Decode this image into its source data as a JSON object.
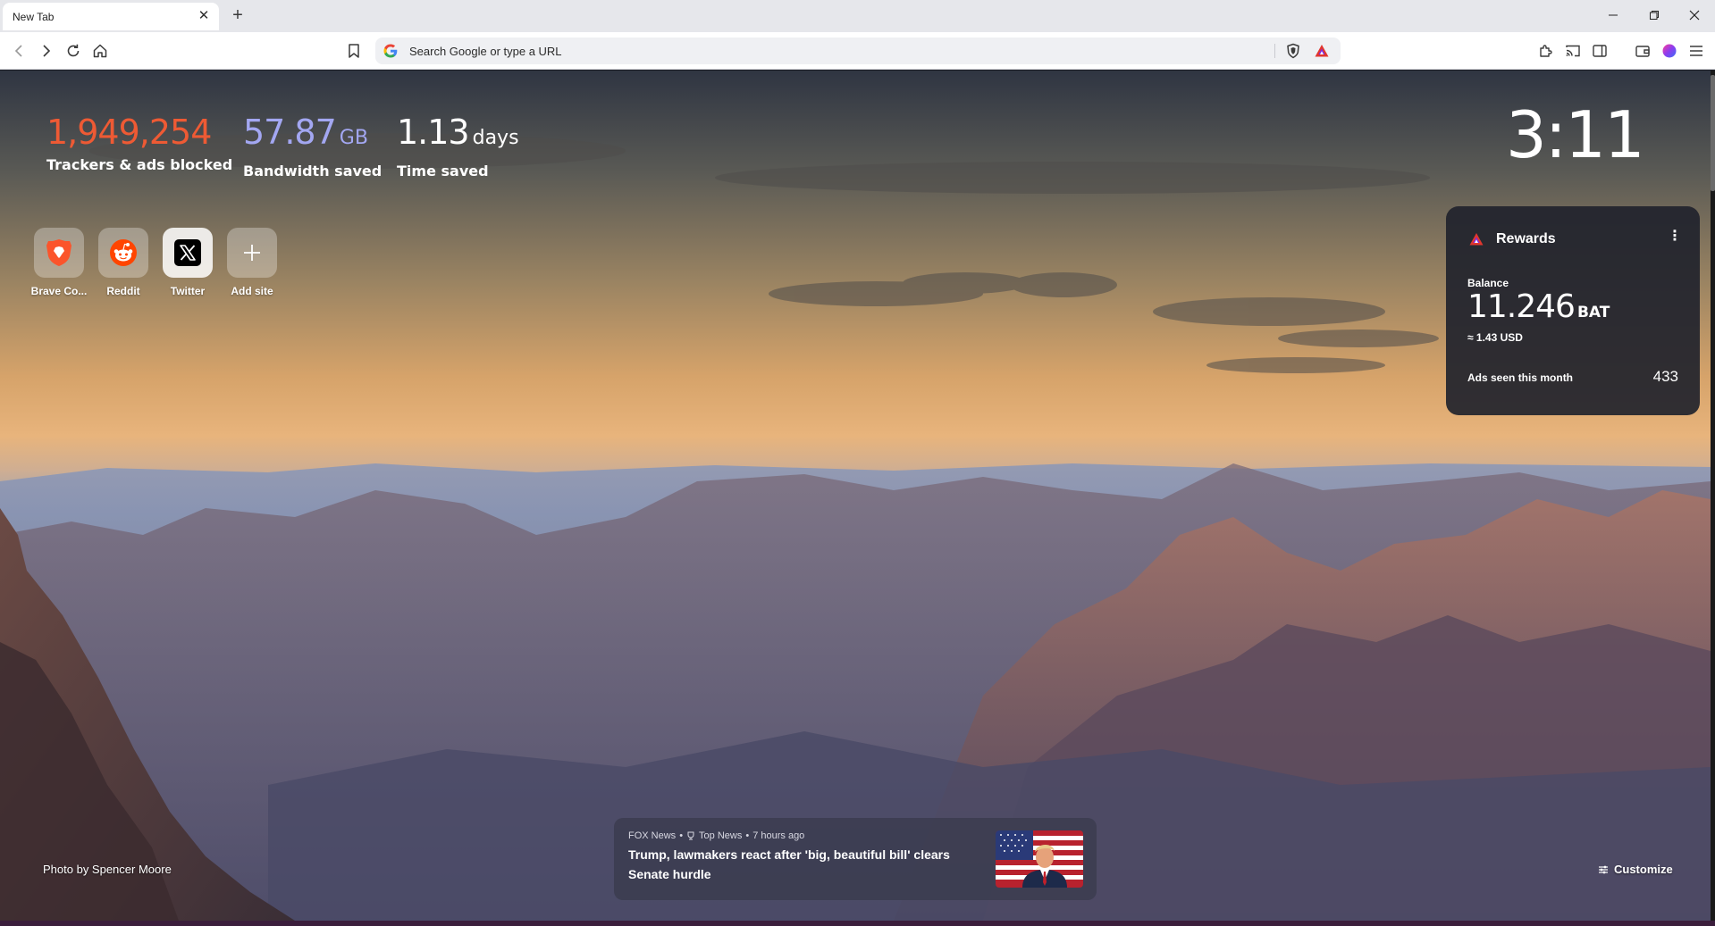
{
  "tab": {
    "title": "New Tab",
    "close_icon": "close-icon",
    "new_tab_icon": "plus-icon"
  },
  "window": {
    "minimize_icon": "minimize-icon",
    "restore_icon": "restore-icon",
    "close_icon": "close-icon"
  },
  "toolbar": {
    "url_placeholder": "Search Google or type a URL",
    "search_engine_icon": "google-icon",
    "icons": [
      "back-icon",
      "forward-icon",
      "reload-icon",
      "home-icon",
      "bookmark-icon",
      "shields-icon",
      "rewards-icon",
      "extensions-icon",
      "cast-icon",
      "sidebar-icon",
      "wallet-icon",
      "profile-icon",
      "menu-icon"
    ]
  },
  "stats": {
    "trackers": {
      "value": "1,949,254",
      "label": "Trackers & ads blocked",
      "color": "#ee5a34"
    },
    "bandwidth": {
      "value": "57.87",
      "unit": "GB",
      "label": "Bandwidth saved",
      "color": "#a3a7f2"
    },
    "time": {
      "value": "1.13",
      "unit": "days",
      "label": "Time saved",
      "color": "#ffffff"
    }
  },
  "clock": "3:11",
  "top_sites": [
    {
      "label": "Brave Co...",
      "icon": "brave-lion-icon"
    },
    {
      "label": "Reddit",
      "icon": "reddit-icon"
    },
    {
      "label": "Twitter",
      "icon": "x-logo-icon"
    },
    {
      "label": "Add site",
      "icon": "plus-icon"
    }
  ],
  "rewards": {
    "title": "Rewards",
    "balance_label": "Balance",
    "balance": "11.246",
    "currency": "BAT",
    "usd": "≈ 1.43 USD",
    "ads_label": "Ads seen this month",
    "ads_count": "433"
  },
  "news": {
    "source": "FOX News",
    "category": "Top News",
    "time": "7 hours ago",
    "headline": "Trump, lawmakers react after 'big, beautiful bill' clears Senate hurdle"
  },
  "photo_credit": "Photo by Spencer Moore",
  "customize_label": "Customize",
  "colors": {
    "brave_orange": "#fb542b",
    "reddit_orange": "#ff4500",
    "panel": "#21232d"
  }
}
